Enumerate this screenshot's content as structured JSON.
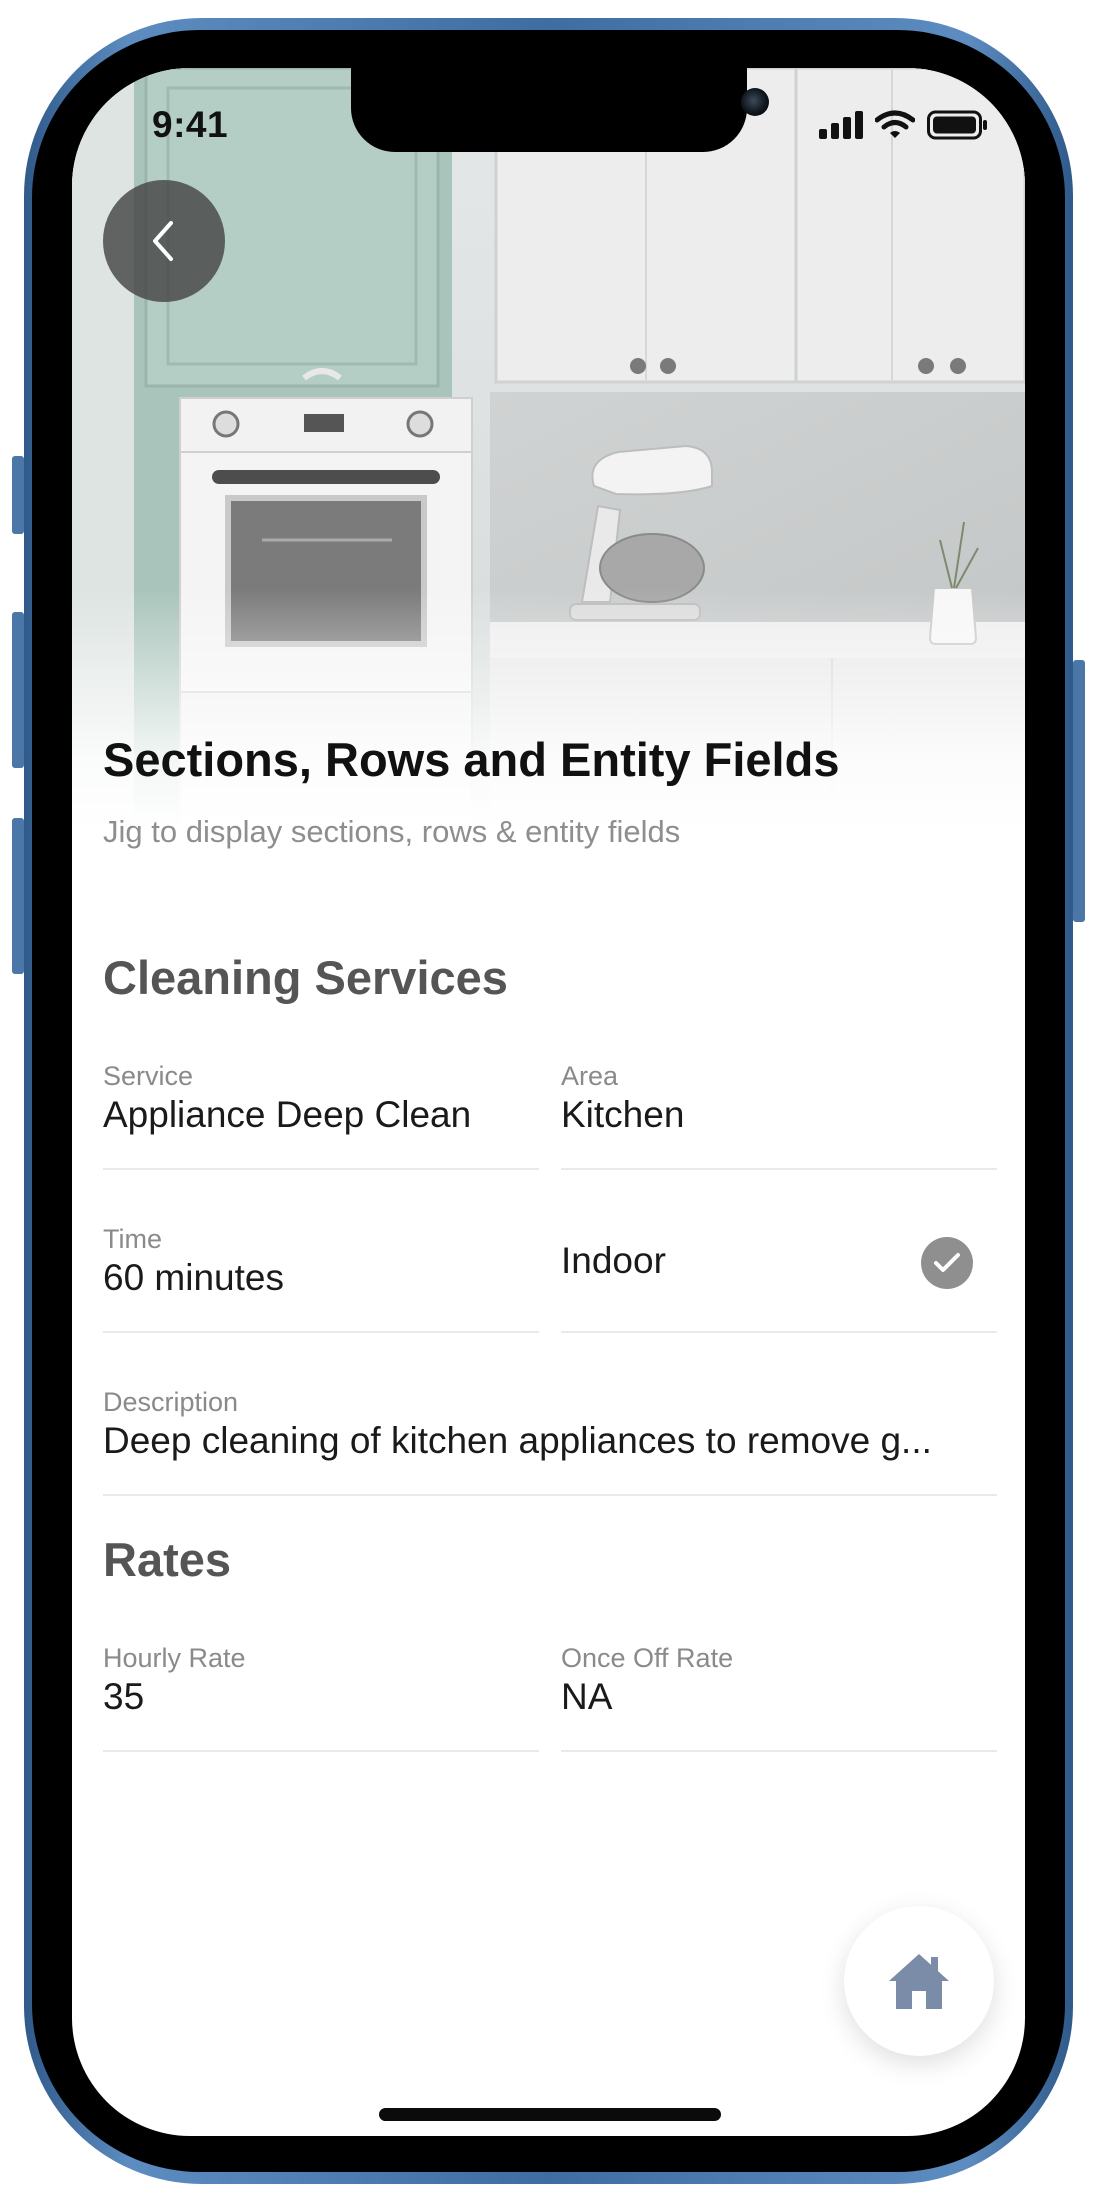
{
  "status_bar": {
    "time": "9:41"
  },
  "header": {
    "title": "Sections, Rows and Entity Fields",
    "subtitle": "Jig to display sections, rows & entity fields"
  },
  "sections": [
    {
      "heading": "Cleaning Services",
      "fields": {
        "service": {
          "label": "Service",
          "value": "Appliance Deep Clean"
        },
        "area": {
          "label": "Area",
          "value": "Kitchen"
        },
        "time": {
          "label": "Time",
          "value": "60 minutes"
        },
        "indoor": {
          "label": "Indoor",
          "checked": true
        },
        "description": {
          "label": "Description",
          "value": "Deep cleaning of kitchen appliances to remove g..."
        }
      }
    },
    {
      "heading": "Rates",
      "fields": {
        "hourly_rate": {
          "label": "Hourly Rate",
          "value": "35"
        },
        "once_off_rate": {
          "label": "Once Off Rate",
          "value": "NA"
        }
      }
    }
  ],
  "icons": {
    "back": "chevron-left-icon",
    "check": "checkmark-circle-icon",
    "home": "home-icon"
  },
  "colors": {
    "frame": "#3e6da2",
    "home_icon": "#7a8ca8",
    "check_bg": "#8f8f8f"
  }
}
